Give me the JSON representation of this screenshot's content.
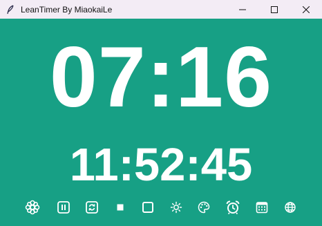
{
  "window": {
    "title": "LeanTimer By MiaokaiLe",
    "background_color": "#17a085"
  },
  "timer": {
    "countdown": "07:16",
    "clock": "11:52:45"
  },
  "toolbar": {
    "icons": [
      "settings-flower-icon",
      "pause-icon",
      "refresh-icon",
      "stop-icon",
      "square-icon",
      "brightness-icon",
      "palette-icon",
      "alarm-clock-icon",
      "calendar-icon",
      "globe-icon"
    ]
  }
}
